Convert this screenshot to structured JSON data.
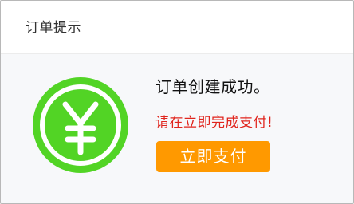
{
  "dialog": {
    "title": "订单提示",
    "message": "订单创建成功。",
    "hint": "请在立即完成支付!",
    "pay_button_label": "立即支付",
    "icon": "yen-icon"
  },
  "colors": {
    "icon_green": "#52d425",
    "hint_red": "#e0251d",
    "button_orange": "#ff9900"
  }
}
